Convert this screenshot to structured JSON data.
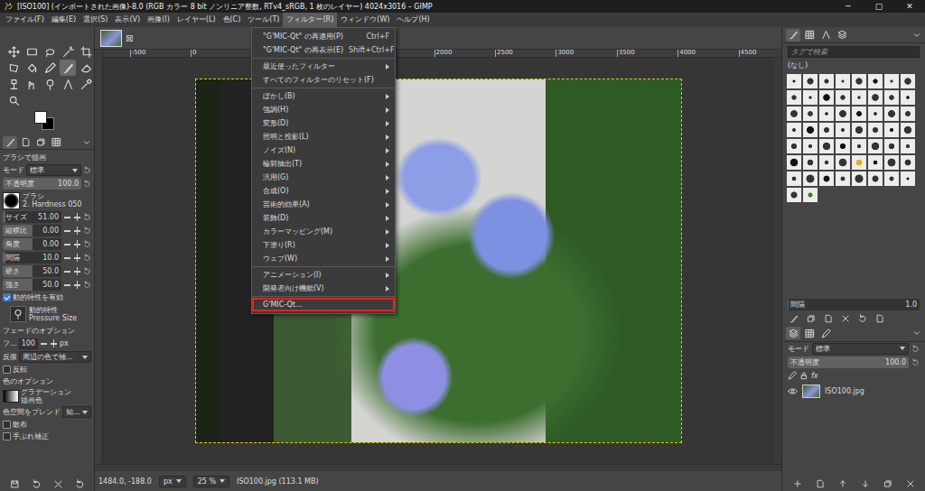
{
  "window": {
    "title": "[ISO100] (インポートされた画像)-8.0 (RGB カラー 8 bit ノンリニア整数, RTv4_sRGB, 1 枚のレイヤー) 4024x3016 – GIMP",
    "controls": [
      "─",
      "▢",
      "✕"
    ]
  },
  "menubar": [
    {
      "label": "ファイル(F)",
      "selected": false
    },
    {
      "label": "編集(E)",
      "selected": false
    },
    {
      "label": "選択(S)",
      "selected": false
    },
    {
      "label": "表示(V)",
      "selected": false
    },
    {
      "label": "画像(I)",
      "selected": false
    },
    {
      "label": "レイヤー(L)",
      "selected": false
    },
    {
      "label": "色(C)",
      "selected": false
    },
    {
      "label": "ツール(T)",
      "selected": false
    },
    {
      "label": "フィルター(R)",
      "selected": true
    },
    {
      "label": "ウィンドウ(W)",
      "selected": false
    },
    {
      "label": "ヘルプ(H)",
      "selected": false
    }
  ],
  "toolbox": {
    "tools": [
      {
        "selected": false
      },
      {
        "selected": false
      },
      {
        "selected": false
      },
      {
        "selected": false
      },
      {
        "selected": false
      },
      {
        "selected": false
      },
      {
        "selected": false
      },
      {
        "selected": false
      },
      {
        "selected": true
      },
      {
        "selected": false
      },
      {
        "selected": false
      },
      {
        "selected": false
      },
      {
        "selected": false
      },
      {
        "selected": false
      },
      {
        "selected": false
      },
      {
        "selected": false
      }
    ],
    "dock_tabs": [
      {
        "selected": true
      },
      {
        "selected": false
      },
      {
        "selected": false
      },
      {
        "selected": false
      }
    ]
  },
  "tool_options": [
    {
      "kind": "heading",
      "label": "ブラシで描画"
    },
    {
      "kind": "select",
      "label": "モード",
      "value": "標準"
    },
    {
      "kind": "bar",
      "label": "不透明度",
      "value": "100.0",
      "level": 1.0
    },
    {
      "kind": "brush",
      "label": "ブラシ",
      "value": "2. Hardness 050"
    },
    {
      "kind": "slider",
      "label": "サイズ",
      "value": "51.00",
      "level": 0.05
    },
    {
      "kind": "slider",
      "label": "縦横比",
      "value": "0.00",
      "level": 0.5
    },
    {
      "kind": "slider",
      "label": "角度",
      "value": "0.00",
      "level": 0.5
    },
    {
      "kind": "slider",
      "label": "間隔",
      "value": "10.0",
      "level": 0.05
    },
    {
      "kind": "slider",
      "label": "硬さ",
      "value": "50.0",
      "level": 0.5
    },
    {
      "kind": "slider",
      "label": "強さ",
      "value": "50.0",
      "level": 0.5
    },
    {
      "kind": "checkbox",
      "label": "動的特性を有効",
      "checked": true
    },
    {
      "kind": "dynamics",
      "label": "動的特性",
      "value": "Pressure Size"
    },
    {
      "kind": "heading",
      "label": "フェードのオプション"
    },
    {
      "kind": "spinner",
      "label": "フ...",
      "value": "100",
      "unit": "px"
    },
    {
      "kind": "select",
      "label": "反復",
      "value": "周辺の色で補..."
    },
    {
      "kind": "checkbox",
      "label": "反転",
      "checked": false
    },
    {
      "kind": "heading",
      "label": "色のオプション"
    },
    {
      "kind": "gradient",
      "label": "グラデーション",
      "value": "描画色"
    },
    {
      "kind": "select",
      "label": "色空間をブレンド",
      "value": "知..."
    },
    {
      "kind": "checkbox",
      "label": "散布",
      "checked": false
    },
    {
      "kind": "checkbox",
      "label": "手ぶれ補正",
      "checked": false
    }
  ],
  "image_tabs": [
    {
      "close": "⊠",
      "selected": true
    }
  ],
  "rulers": {
    "horizontal": [
      "-500",
      "0",
      "2000",
      "2500",
      "3000",
      "3500",
      "4000",
      "4500"
    ]
  },
  "filters_menu": [
    {
      "kind": "item",
      "label": "\"G'MIC-Qt\" の再適用(P)",
      "shortcut": "Ctrl+F",
      "submenu": false,
      "highlighted": false
    },
    {
      "kind": "item",
      "label": "\"G'MIC-Qt\" の再表示(E)",
      "shortcut": "Shift+Ctrl+F",
      "submenu": false,
      "highlighted": false
    },
    {
      "kind": "separator"
    },
    {
      "kind": "item",
      "label": "最近使ったフィルター",
      "shortcut": "",
      "submenu": true,
      "highlighted": false
    },
    {
      "kind": "item",
      "label": "すべてのフィルターのリセット(F)",
      "shortcut": "",
      "submenu": false,
      "highlighted": false
    },
    {
      "kind": "separator"
    },
    {
      "kind": "item",
      "label": "ぼかし(B)",
      "shortcut": "",
      "submenu": true,
      "highlighted": false
    },
    {
      "kind": "item",
      "label": "強調(H)",
      "shortcut": "",
      "submenu": true,
      "highlighted": false
    },
    {
      "kind": "item",
      "label": "変形(D)",
      "shortcut": "",
      "submenu": true,
      "highlighted": false
    },
    {
      "kind": "item",
      "label": "照明と投影(L)",
      "shortcut": "",
      "submenu": true,
      "highlighted": false
    },
    {
      "kind": "item",
      "label": "ノイズ(N)",
      "shortcut": "",
      "submenu": true,
      "highlighted": false
    },
    {
      "kind": "item",
      "label": "輪郭抽出(T)",
      "shortcut": "",
      "submenu": true,
      "highlighted": false
    },
    {
      "kind": "item",
      "label": "汎用(G)",
      "shortcut": "",
      "submenu": true,
      "highlighted": false
    },
    {
      "kind": "item",
      "label": "合成(O)",
      "shortcut": "",
      "submenu": true,
      "highlighted": false
    },
    {
      "kind": "item",
      "label": "芸術的効果(A)",
      "shortcut": "",
      "submenu": true,
      "highlighted": false
    },
    {
      "kind": "item",
      "label": "装飾(D)",
      "shortcut": "",
      "submenu": true,
      "highlighted": false
    },
    {
      "kind": "item",
      "label": "カラーマッピング(M)",
      "shortcut": "",
      "submenu": true,
      "highlighted": false
    },
    {
      "kind": "item",
      "label": "下塗り(R)",
      "shortcut": "",
      "submenu": true,
      "highlighted": false
    },
    {
      "kind": "item",
      "label": "ウェブ(W)",
      "shortcut": "",
      "submenu": true,
      "highlighted": false
    },
    {
      "kind": "separator"
    },
    {
      "kind": "item",
      "label": "アニメーション(I)",
      "shortcut": "",
      "submenu": true,
      "highlighted": false
    },
    {
      "kind": "item",
      "label": "開発者向け機能(V)",
      "shortcut": "",
      "submenu": true,
      "highlighted": false
    },
    {
      "kind": "separator"
    },
    {
      "kind": "item",
      "label": "G'MIC-Qt...",
      "shortcut": "",
      "submenu": false,
      "highlighted": true
    }
  ],
  "status_bar": {
    "coords": "1484.0, -188.0",
    "unit": "px",
    "zoom": "25 %",
    "file": "ISO100.jpg (113.1 MB)"
  },
  "brushes": {
    "tabs": [
      {
        "selected": true
      },
      {
        "selected": false
      },
      {
        "selected": false
      },
      {
        "selected": false
      }
    ],
    "search_placeholder": "タグで検索",
    "tag": "(なし)",
    "spacing": {
      "label": "間隔",
      "value": "1.0",
      "level": 0.01
    }
  },
  "layers": {
    "tabs": [
      {
        "selected": true
      },
      {
        "selected": false
      },
      {
        "selected": false
      }
    ],
    "mode_label": "モード",
    "mode": "標準",
    "opacity_label": "不透明度",
    "opacity": "100.0",
    "opacity_level": 1.0,
    "fx": "fx",
    "items": [
      {
        "name": "ISO100.jpg",
        "visible": true,
        "selected": false
      }
    ]
  }
}
